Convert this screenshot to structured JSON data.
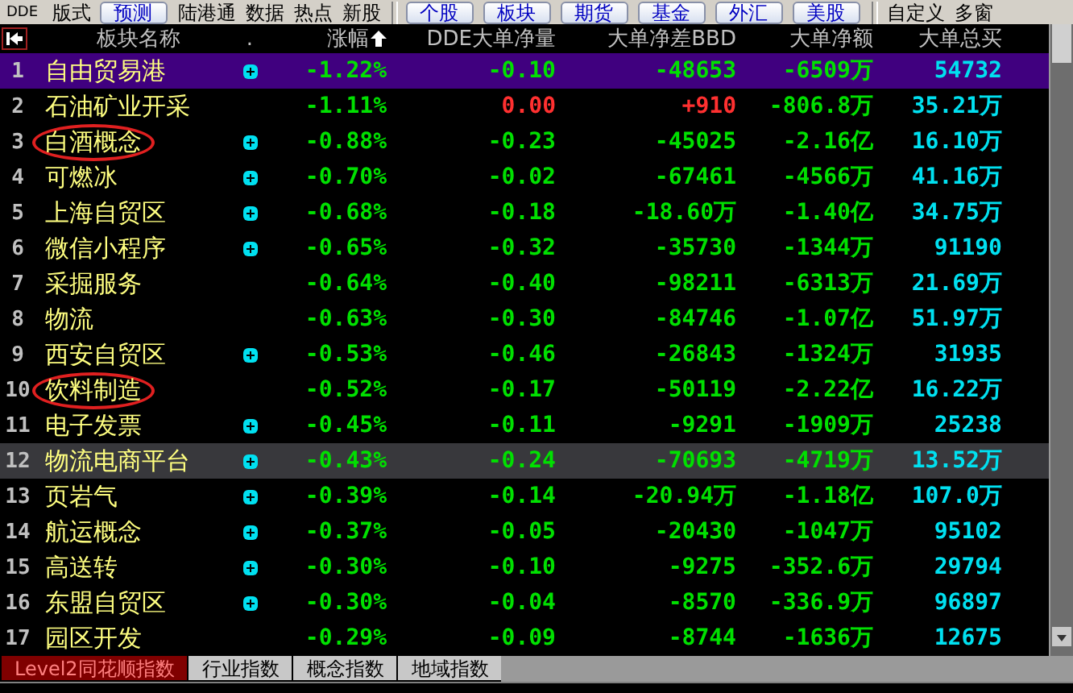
{
  "toolbar": [
    {
      "label": "DDE",
      "kind": "small"
    },
    {
      "label": "版式",
      "kind": "plain"
    },
    {
      "label": "预测",
      "kind": "button"
    },
    {
      "label": "陆港通",
      "kind": "plain"
    },
    {
      "label": "数据",
      "kind": "plain"
    },
    {
      "label": "热点",
      "kind": "plain"
    },
    {
      "label": "新股",
      "kind": "plain"
    },
    {
      "kind": "separator"
    },
    {
      "label": "个股",
      "kind": "button"
    },
    {
      "label": "板块",
      "kind": "button"
    },
    {
      "label": "期货",
      "kind": "button"
    },
    {
      "label": "基金",
      "kind": "button"
    },
    {
      "label": "外汇",
      "kind": "button"
    },
    {
      "label": "美股",
      "kind": "button"
    },
    {
      "kind": "separator"
    },
    {
      "label": "自定义",
      "kind": "plain"
    },
    {
      "label": "多窗",
      "kind": "plain"
    }
  ],
  "table": {
    "columns": [
      {
        "label": "板块名称",
        "sorted": false
      },
      {
        "label": ".",
        "sorted": false
      },
      {
        "label": "涨幅",
        "sorted": true
      },
      {
        "label": "DDE大单净量",
        "sorted": false
      },
      {
        "label": "大单净差BBD",
        "sorted": false
      },
      {
        "label": "大单净额",
        "sorted": false
      },
      {
        "label": "大单总买",
        "sorted": false
      }
    ],
    "rows": [
      {
        "index": "1",
        "name": "自由贸易港",
        "plus": true,
        "change": "-1.22%",
        "dde": "-0.10",
        "dde_up": false,
        "bbd": "-48653",
        "bbd_up": false,
        "net": "-6509万",
        "buy": "54732",
        "selected": true,
        "highlighted": false,
        "circled": false
      },
      {
        "index": "2",
        "name": "石油矿业开采",
        "plus": false,
        "change": "-1.11%",
        "dde": "0.00",
        "dde_up": true,
        "bbd": "+910",
        "bbd_up": true,
        "net": "-806.8万",
        "buy": "35.21万",
        "selected": false,
        "highlighted": false,
        "circled": false
      },
      {
        "index": "3",
        "name": "白酒概念",
        "plus": true,
        "change": "-0.88%",
        "dde": "-0.23",
        "dde_up": false,
        "bbd": "-45025",
        "bbd_up": false,
        "net": "-2.16亿",
        "buy": "16.10万",
        "selected": false,
        "highlighted": false,
        "circled": true
      },
      {
        "index": "4",
        "name": "可燃冰",
        "plus": true,
        "change": "-0.70%",
        "dde": "-0.02",
        "dde_up": false,
        "bbd": "-67461",
        "bbd_up": false,
        "net": "-4566万",
        "buy": "41.16万",
        "selected": false,
        "highlighted": false,
        "circled": false
      },
      {
        "index": "5",
        "name": "上海自贸区",
        "plus": true,
        "change": "-0.68%",
        "dde": "-0.18",
        "dde_up": false,
        "bbd": "-18.60万",
        "bbd_up": false,
        "net": "-1.40亿",
        "buy": "34.75万",
        "selected": false,
        "highlighted": false,
        "circled": false
      },
      {
        "index": "6",
        "name": "微信小程序",
        "plus": true,
        "change": "-0.65%",
        "dde": "-0.32",
        "dde_up": false,
        "bbd": "-35730",
        "bbd_up": false,
        "net": "-1344万",
        "buy": "91190",
        "selected": false,
        "highlighted": false,
        "circled": false
      },
      {
        "index": "7",
        "name": "采掘服务",
        "plus": false,
        "change": "-0.64%",
        "dde": "-0.40",
        "dde_up": false,
        "bbd": "-98211",
        "bbd_up": false,
        "net": "-6313万",
        "buy": "21.69万",
        "selected": false,
        "highlighted": false,
        "circled": false
      },
      {
        "index": "8",
        "name": "物流",
        "plus": false,
        "change": "-0.63%",
        "dde": "-0.30",
        "dde_up": false,
        "bbd": "-84746",
        "bbd_up": false,
        "net": "-1.07亿",
        "buy": "51.97万",
        "selected": false,
        "highlighted": false,
        "circled": false
      },
      {
        "index": "9",
        "name": "西安自贸区",
        "plus": true,
        "change": "-0.53%",
        "dde": "-0.46",
        "dde_up": false,
        "bbd": "-26843",
        "bbd_up": false,
        "net": "-1324万",
        "buy": "31935",
        "selected": false,
        "highlighted": false,
        "circled": false
      },
      {
        "index": "10",
        "name": "饮料制造",
        "plus": false,
        "change": "-0.52%",
        "dde": "-0.17",
        "dde_up": false,
        "bbd": "-50119",
        "bbd_up": false,
        "net": "-2.22亿",
        "buy": "16.22万",
        "selected": false,
        "highlighted": false,
        "circled": true
      },
      {
        "index": "11",
        "name": "电子发票",
        "plus": true,
        "change": "-0.45%",
        "dde": "-0.11",
        "dde_up": false,
        "bbd": "-9291",
        "bbd_up": false,
        "net": "-1909万",
        "buy": "25238",
        "selected": false,
        "highlighted": false,
        "circled": false
      },
      {
        "index": "12",
        "name": "物流电商平台",
        "plus": true,
        "change": "-0.43%",
        "dde": "-0.24",
        "dde_up": false,
        "bbd": "-70693",
        "bbd_up": false,
        "net": "-4719万",
        "buy": "13.52万",
        "selected": false,
        "highlighted": true,
        "circled": false
      },
      {
        "index": "13",
        "name": "页岩气",
        "plus": true,
        "change": "-0.39%",
        "dde": "-0.14",
        "dde_up": false,
        "bbd": "-20.94万",
        "bbd_up": false,
        "net": "-1.18亿",
        "buy": "107.0万",
        "selected": false,
        "highlighted": false,
        "circled": false
      },
      {
        "index": "14",
        "name": "航运概念",
        "plus": true,
        "change": "-0.37%",
        "dde": "-0.05",
        "dde_up": false,
        "bbd": "-20430",
        "bbd_up": false,
        "net": "-1047万",
        "buy": "95102",
        "selected": false,
        "highlighted": false,
        "circled": false
      },
      {
        "index": "15",
        "name": "高送转",
        "plus": true,
        "change": "-0.30%",
        "dde": "-0.10",
        "dde_up": false,
        "bbd": "-9275",
        "bbd_up": false,
        "net": "-352.6万",
        "buy": "29794",
        "selected": false,
        "highlighted": false,
        "circled": false
      },
      {
        "index": "16",
        "name": "东盟自贸区",
        "plus": true,
        "change": "-0.30%",
        "dde": "-0.04",
        "dde_up": false,
        "bbd": "-8570",
        "bbd_up": false,
        "net": "-336.9万",
        "buy": "96897",
        "selected": false,
        "highlighted": false,
        "circled": false
      },
      {
        "index": "17",
        "name": "园区开发",
        "plus": false,
        "change": "-0.29%",
        "dde": "-0.09",
        "dde_up": false,
        "bbd": "-8744",
        "bbd_up": false,
        "net": "-1636万",
        "buy": "12675",
        "selected": false,
        "highlighted": false,
        "circled": false
      }
    ]
  },
  "bottom_tabs": [
    {
      "label": "Level2同花顺指数",
      "selected": true
    },
    {
      "label": "行业指数",
      "selected": false
    },
    {
      "label": "概念指数",
      "selected": false
    },
    {
      "label": "地域指数",
      "selected": false
    }
  ]
}
